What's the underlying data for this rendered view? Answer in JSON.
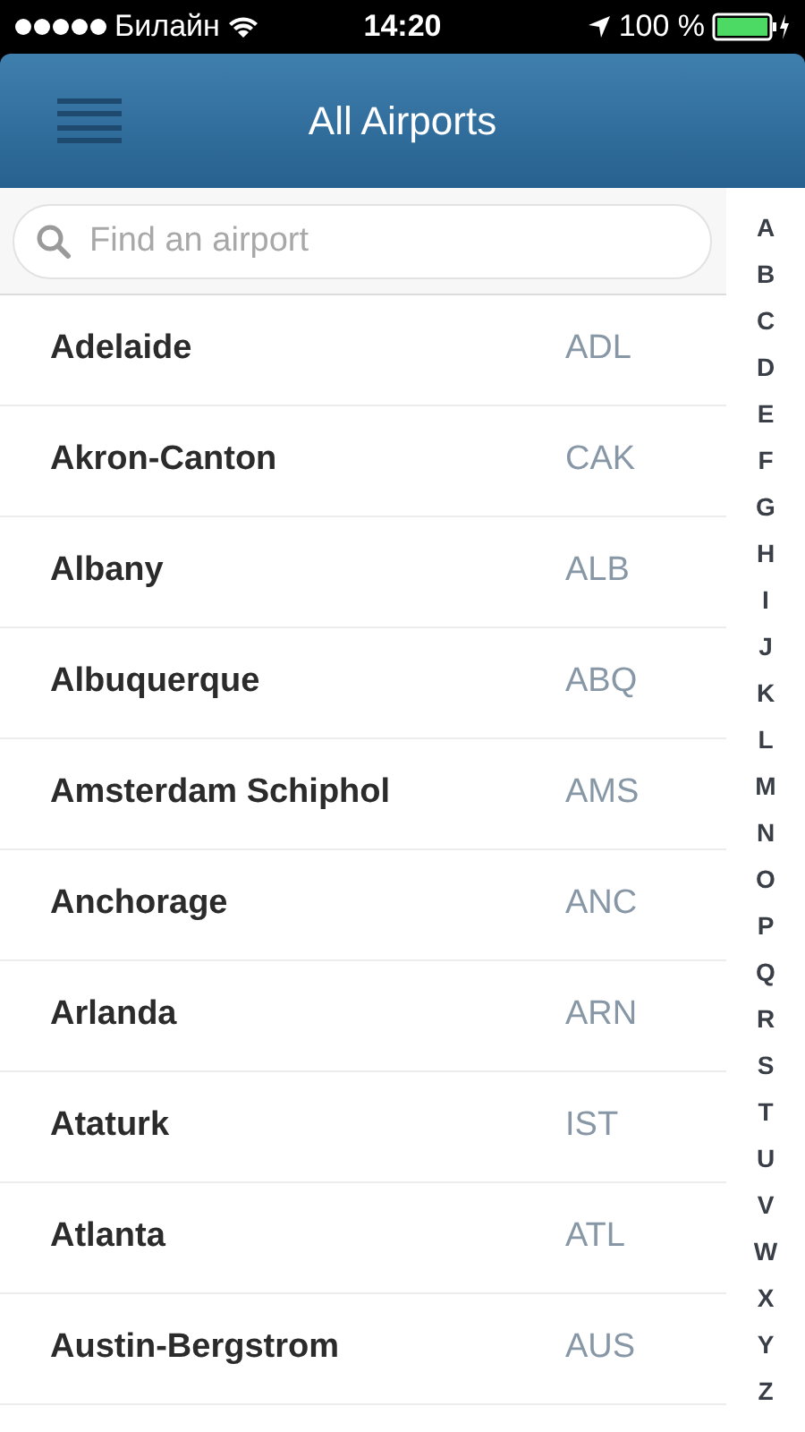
{
  "status_bar": {
    "carrier": "Билайн",
    "time": "14:20",
    "battery": "100 %"
  },
  "header": {
    "title": "All Airports"
  },
  "search": {
    "placeholder": "Find an airport"
  },
  "airports": [
    {
      "name": "Adelaide",
      "code": "ADL"
    },
    {
      "name": "Akron-Canton",
      "code": "CAK"
    },
    {
      "name": "Albany",
      "code": "ALB"
    },
    {
      "name": "Albuquerque",
      "code": "ABQ"
    },
    {
      "name": "Amsterdam Schiphol",
      "code": "AMS"
    },
    {
      "name": "Anchorage",
      "code": "ANC"
    },
    {
      "name": "Arlanda",
      "code": "ARN"
    },
    {
      "name": "Ataturk",
      "code": "IST"
    },
    {
      "name": "Atlanta",
      "code": "ATL"
    },
    {
      "name": "Austin-Bergstrom",
      "code": "AUS"
    }
  ],
  "index": [
    "A",
    "B",
    "C",
    "D",
    "E",
    "F",
    "G",
    "H",
    "I",
    "J",
    "K",
    "L",
    "M",
    "N",
    "O",
    "P",
    "Q",
    "R",
    "S",
    "T",
    "U",
    "V",
    "W",
    "X",
    "Y",
    "Z"
  ]
}
